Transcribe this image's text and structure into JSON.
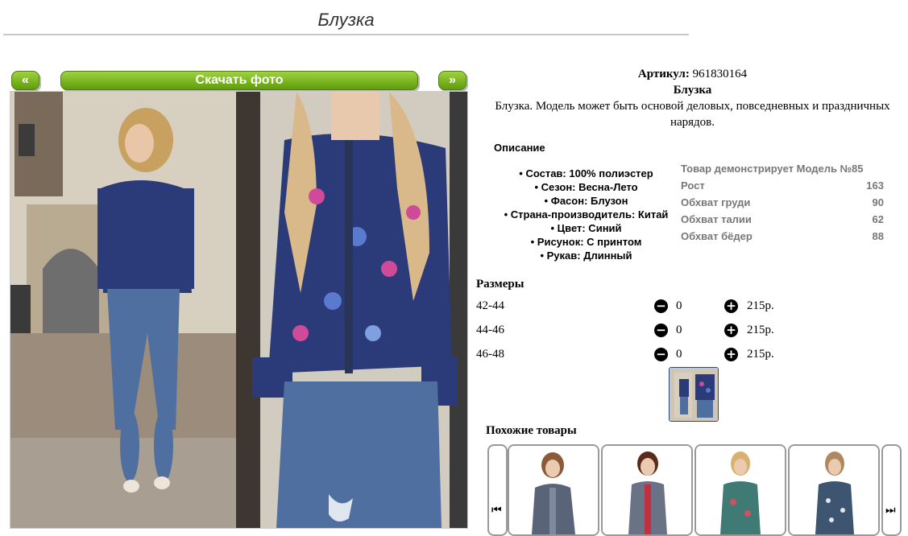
{
  "page": {
    "title": "Блузка"
  },
  "toolbar": {
    "prev_label": "«",
    "download_label": "Скачать фото",
    "next_label": "»"
  },
  "product": {
    "article_label": "Артикул:",
    "article_value": "961830164",
    "name": "Блузка",
    "description_line1": "Блузка. Модель может быть основой деловых, повседневных и праздничных",
    "description_line2": "нарядов."
  },
  "description": {
    "title": "Описание",
    "features": [
      "Состав: 100% полиэстер",
      "Сезон: Весна-Лето",
      "Фасон: Блузон",
      "Страна-производитель: Китай",
      "Цвет: Синий",
      "Рисунок: С принтом",
      "Рукав: Длинный"
    ]
  },
  "model": {
    "rows": [
      {
        "label": "Товар демонстрирует Модель №85",
        "value": ""
      },
      {
        "label": "Рост",
        "value": "163"
      },
      {
        "label": "Обхват груди",
        "value": "90"
      },
      {
        "label": "Обхват талии",
        "value": "62"
      },
      {
        "label": "Обхват бёдер",
        "value": "88"
      }
    ]
  },
  "sizes": {
    "title": "Размеры",
    "rows": [
      {
        "size": "42-44",
        "qty": "0",
        "price": "215р."
      },
      {
        "size": "44-46",
        "qty": "0",
        "price": "215р."
      },
      {
        "size": "46-48",
        "qty": "0",
        "price": "215р."
      }
    ]
  },
  "similar": {
    "title": "Похожие товары",
    "prev_icon": "skip-left-icon",
    "next_icon": "skip-right-icon"
  },
  "colors": {
    "button_green": "#7bbf24",
    "navy_blouse": "#2b3a78",
    "jeans": "#4f6fa0"
  }
}
